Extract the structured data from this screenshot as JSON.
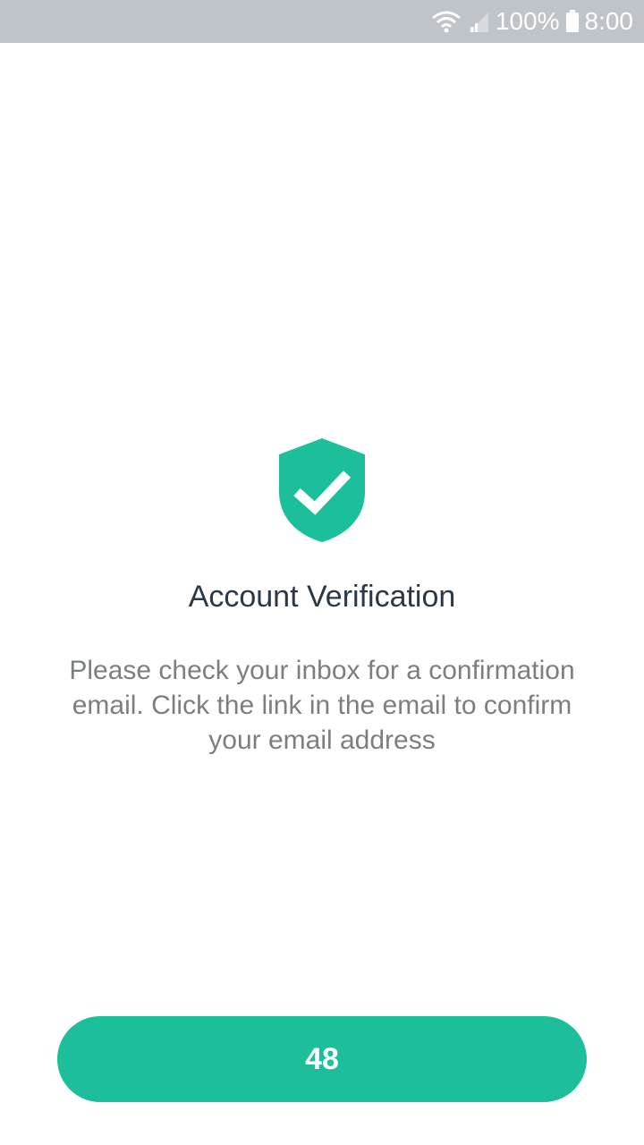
{
  "status_bar": {
    "battery_text": "100%",
    "time": "8:00",
    "icons": [
      "wifi-icon",
      "signal-icon",
      "battery-icon"
    ]
  },
  "verification": {
    "icon": "shield-check-icon",
    "title": "Account Verification",
    "message": "Please check your inbox for a confirmation email. Click the link in the email to confirm your email address"
  },
  "countdown_button": {
    "label": "48"
  },
  "colors": {
    "accent": "#1dbf9b",
    "status_bar": "#bfc4c8",
    "title": "#2a3848",
    "message": "#7c7f82"
  }
}
